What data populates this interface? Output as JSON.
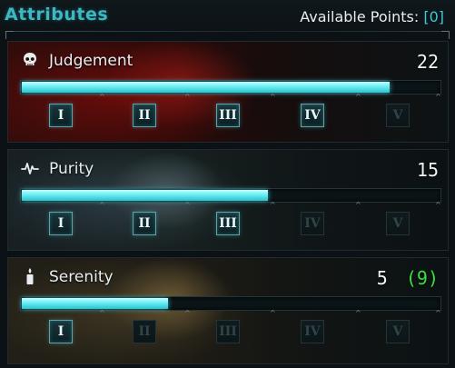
{
  "header": {
    "title": "Attributes",
    "available_label": "Available Points:",
    "available_value": "[0]"
  },
  "attributes": [
    {
      "name": "Judgement",
      "icon": "skull-icon",
      "value": "22",
      "bonus": "",
      "progress": 0.88,
      "tiers": [
        {
          "label": "I",
          "unlocked": true
        },
        {
          "label": "II",
          "unlocked": true
        },
        {
          "label": "III",
          "unlocked": true
        },
        {
          "label": "IV",
          "unlocked": true
        },
        {
          "label": "V",
          "unlocked": false
        }
      ]
    },
    {
      "name": "Purity",
      "icon": "pulse-icon",
      "value": "15",
      "bonus": "",
      "progress": 0.59,
      "tiers": [
        {
          "label": "I",
          "unlocked": true
        },
        {
          "label": "II",
          "unlocked": true
        },
        {
          "label": "III",
          "unlocked": true
        },
        {
          "label": "IV",
          "unlocked": false
        },
        {
          "label": "V",
          "unlocked": false
        }
      ]
    },
    {
      "name": "Serenity",
      "icon": "candle-icon",
      "value": "5",
      "bonus": "(9)",
      "progress": 0.35,
      "tiers": [
        {
          "label": "I",
          "unlocked": true
        },
        {
          "label": "II",
          "unlocked": false
        },
        {
          "label": "III",
          "unlocked": false
        },
        {
          "label": "IV",
          "unlocked": false
        },
        {
          "label": "V",
          "unlocked": false
        }
      ]
    }
  ],
  "colors": {
    "accent": "#3fb7c2",
    "bar": "#6ff0f5",
    "bonus": "#39e23a"
  }
}
